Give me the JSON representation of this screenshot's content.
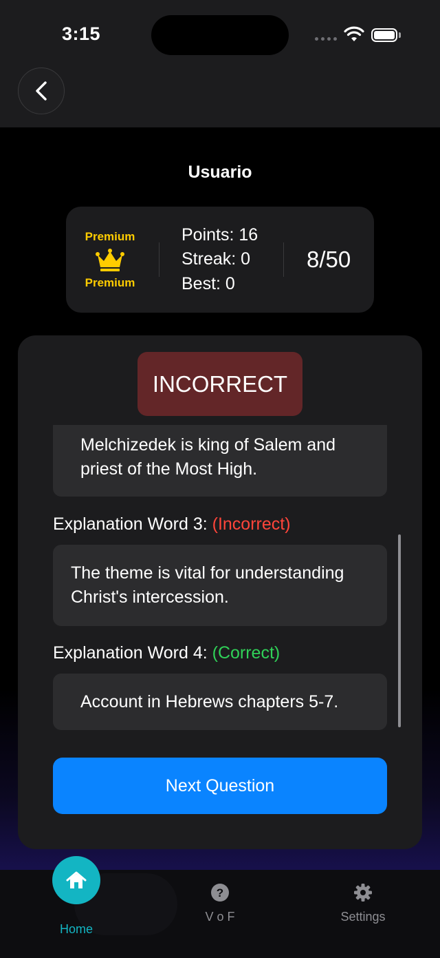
{
  "status_bar": {
    "time": "3:15"
  },
  "header": {
    "username": "Usuario"
  },
  "stats": {
    "premium_top": "Premium",
    "premium_bottom": "Premium",
    "points": "Points: 16",
    "streak": "Streak: 0",
    "best": "Best: 0",
    "progress": "8/50"
  },
  "quiz": {
    "result": "INCORRECT",
    "prev_explanation": "Melchizedek is king of Salem and priest of the Most High.",
    "explanations": [
      {
        "heading": "Explanation Word 3:",
        "status": "(Incorrect)",
        "text": "The theme is vital for understanding Christ's intercession."
      },
      {
        "heading": "Explanation Word 4:",
        "status": "(Correct)",
        "text": "Account in Hebrews chapters 5-7."
      }
    ],
    "next_label": "Next Question"
  },
  "tabs": [
    {
      "label": "Home",
      "icon": "home-icon",
      "active": true
    },
    {
      "label": "V o F",
      "icon": "question-icon",
      "active": false
    },
    {
      "label": "Settings",
      "icon": "gear-icon",
      "active": false
    }
  ],
  "colors": {
    "accent": "#0a84ff",
    "active_tab": "#13b5c3",
    "incorrect": "#ff453a",
    "correct": "#30d158",
    "premium": "#ffcc00",
    "badge_bg": "#632628"
  }
}
